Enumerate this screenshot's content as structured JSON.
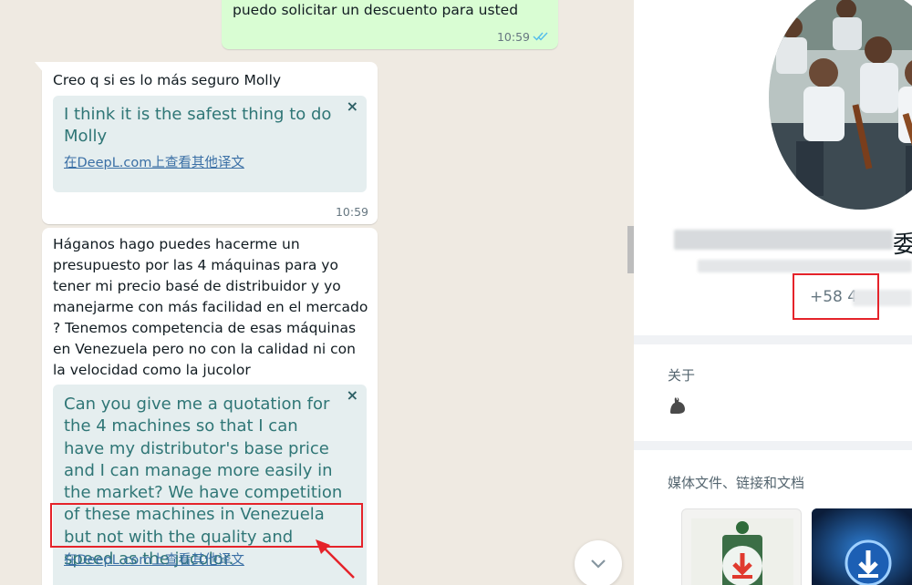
{
  "chat": {
    "messages": [
      {
        "direction": "out",
        "text": "puedo solicitar un descuento para usted",
        "time": "10:59",
        "status_icon": "double-check-icon"
      },
      {
        "direction": "in",
        "text": "Creo q si es lo más seguro Molly",
        "translation": "I think it is the safest thing to do Molly",
        "translation_link": "在DeepL.com上查看其他译文",
        "time": "10:59"
      },
      {
        "direction": "in",
        "text": "Háganos hago puedes hacerme un presupuesto por las 4 máquinas para yo tener mi precio basé de distribuidor y yo manejarme con más facilidad en el mercado ? Tenemos competencia de esas máquinas en Venezuela pero no con la calidad ni con la velocidad como la jucolor",
        "translation": "Can you give me a quotation for the 4 machines so that I can have my distributor's base price and I can manage more easily in the market? We have competition of these machines in Venezuela but not with the quality and speed as the jucolor.",
        "translation_link": "在DeepL.com上查看其他译文"
      }
    ],
    "close_symbol": "×",
    "scroll_down_icon": "chevron-down-icon"
  },
  "contact": {
    "name_suffix": "委",
    "phone_visible": "+58 4",
    "about_label": "关于",
    "about_value_icon": "flexed-biceps-emoji",
    "media_label": "媒体文件、链接和文档",
    "media_icons": [
      "download-icon",
      "download-icon"
    ]
  },
  "colors": {
    "chat_bg": "#efeae2",
    "outgoing_bubble": "#d9fdd3",
    "incoming_bubble": "#ffffff",
    "translation_bg": "#e5eeef",
    "translation_text": "#2f7676",
    "annotation_red": "#e5232a",
    "read_tick": "#53bdeb"
  }
}
